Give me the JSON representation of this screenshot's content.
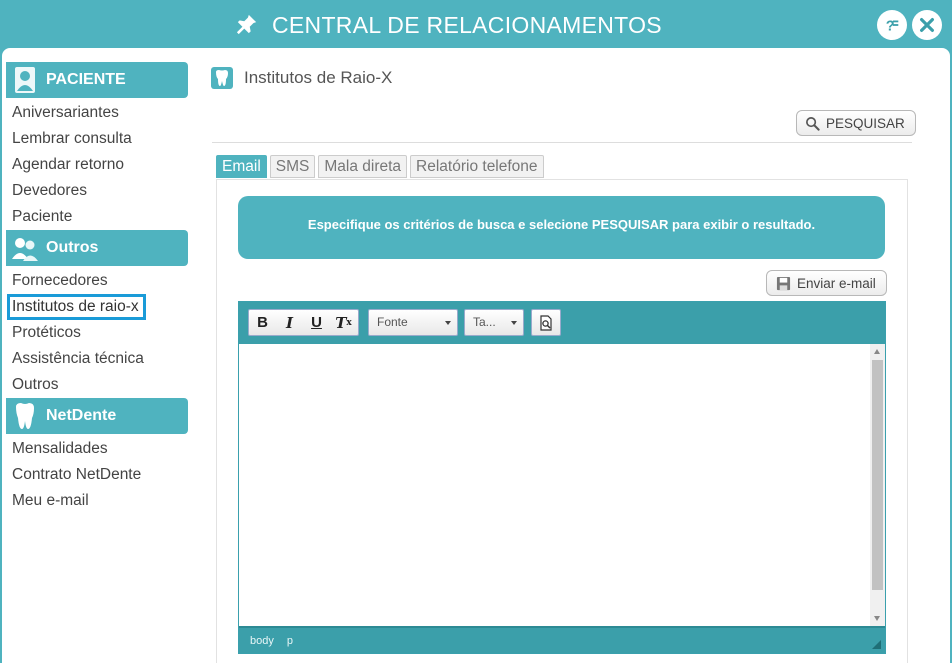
{
  "window": {
    "title": "CENTRAL DE RELACIONAMENTOS",
    "icons": {
      "pin": "pin-icon",
      "help": "help-icon",
      "close": "close-icon"
    }
  },
  "sidebar": {
    "sections": [
      {
        "title": "PACIENTE",
        "icon": "patient-icon",
        "items": [
          "Aniversariantes",
          "Lembrar consulta",
          "Agendar retorno",
          "Devedores",
          "Paciente"
        ]
      },
      {
        "title": "Outros",
        "icon": "people-icon",
        "items": [
          "Fornecedores",
          "Institutos de raio-x",
          "Protéticos",
          "Assistência técnica",
          "Outros"
        ]
      },
      {
        "title": "NetDente",
        "icon": "tooth-icon",
        "items": [
          "Mensalidades",
          "Contrato NetDente",
          "Meu e-mail"
        ]
      }
    ],
    "active_item": "Institutos de raio-x"
  },
  "content": {
    "page_title": "Institutos de Raio-X",
    "search_button": "PESQUISAR",
    "tabs": [
      "Email",
      "SMS",
      "Mala direta",
      "Relatório telefone"
    ],
    "active_tab": "Email",
    "info_message": "Especifique os critérios de busca e selecione PESQUISAR para exibir o resultado.",
    "send_email_button": "Enviar e-mail",
    "editor": {
      "bold": "B",
      "italic": "I",
      "underline": "U",
      "remove_format": "T",
      "remove_format_sub": "x",
      "font_select": "Fonte",
      "size_select": "Ta...",
      "status_path": [
        "body",
        "p"
      ]
    }
  },
  "colors": {
    "accent": "#4fb3bf",
    "editor_bar": "#3b9faa",
    "active_outline": "#1a9bd8"
  }
}
